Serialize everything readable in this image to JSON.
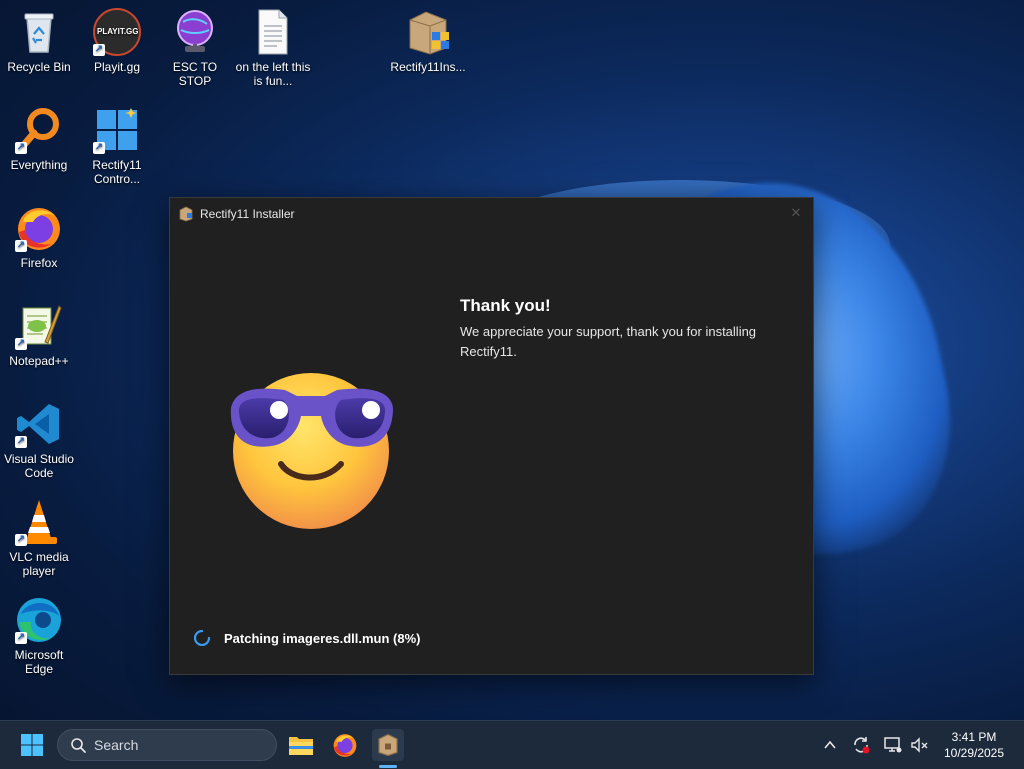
{
  "desktop": {
    "icons": [
      {
        "name": "recycle-bin",
        "label": "Recycle Bin"
      },
      {
        "name": "playit",
        "label": "Playit.gg",
        "logo_text": "PLAYIT.GG"
      },
      {
        "name": "esc-to-stop",
        "label": "ESC TO STOP"
      },
      {
        "name": "text-file",
        "label": "on the left this is fun..."
      },
      {
        "name": "rectify11-installer-file",
        "label": "Rectify11Ins..."
      },
      {
        "name": "everything",
        "label": "Everything"
      },
      {
        "name": "rectify11-control",
        "label": "Rectify11 Contro..."
      },
      {
        "name": "firefox",
        "label": "Firefox"
      },
      {
        "name": "notepadpp",
        "label": "Notepad++"
      },
      {
        "name": "vscode",
        "label": "Visual Studio Code"
      },
      {
        "name": "vlc",
        "label": "VLC media player"
      },
      {
        "name": "edge",
        "label": "Microsoft Edge"
      }
    ]
  },
  "window": {
    "title": "Rectify11 Installer",
    "close_glyph": "✕",
    "heading": "Thank you!",
    "message": "We appreciate your support, thank you for installing Rectify11.",
    "status": "Patching imageres.dll.mun (8%)",
    "progress_percent": 8
  },
  "taskbar": {
    "search_placeholder": "Search",
    "clock_time": "3:41 PM",
    "clock_date": "10/29/2025"
  },
  "colors": {
    "window_bg": "#202020",
    "taskbar_bg": "#1c2a3c",
    "accent": "#5fb2f5"
  }
}
